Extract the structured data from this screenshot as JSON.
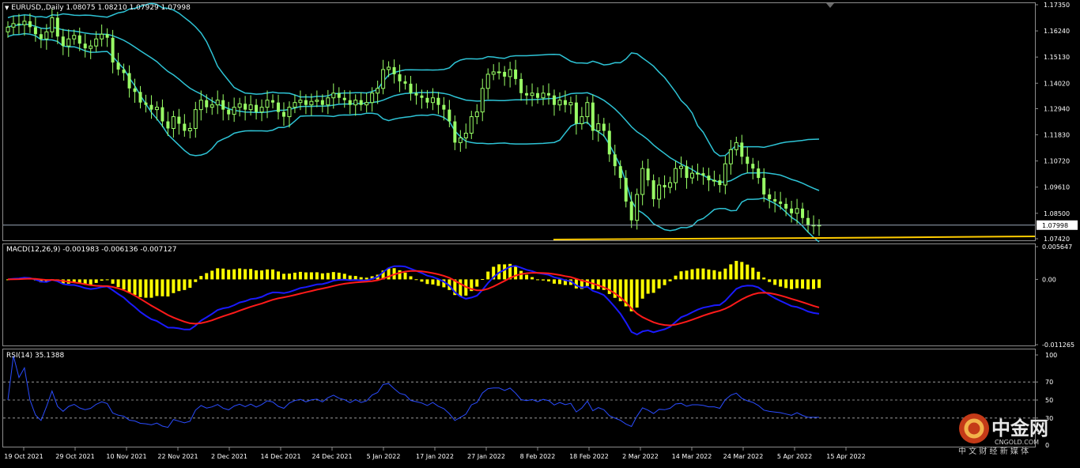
{
  "window": {
    "symbol_title": "EURUSD,,Daily",
    "ohlc_text": "1.08075 1.08210 1.07929 1.07998",
    "current_price": "1.07998"
  },
  "price_axis": [
    "1.17350",
    "1.16240",
    "1.15130",
    "1.14020",
    "1.12940",
    "1.11830",
    "1.10720",
    "1.09610",
    "1.08500",
    "1.07420"
  ],
  "macd": {
    "label": "MACD(12,26,9) -0.001983 -0.006136 -0.007127",
    "axis": [
      "0.005647",
      "0.00",
      "-0.011265"
    ]
  },
  "rsi": {
    "label": "RSI(14) 35.1388",
    "axis": [
      "100",
      "70",
      "50",
      "30",
      "0"
    ],
    "levels": [
      70,
      50,
      30
    ]
  },
  "date_axis": [
    "19 Oct 2021",
    "29 Oct 2021",
    "10 Nov 2021",
    "22 Nov 2021",
    "2 Dec 2021",
    "14 Dec 2021",
    "24 Dec 2021",
    "5 Jan 2022",
    "17 Jan 2022",
    "27 Jan 2022",
    "8 Feb 2022",
    "18 Feb 2022",
    "2 Mar 2022",
    "14 Mar 2022",
    "24 Mar 2022",
    "5 Apr 2022",
    "15 Apr 2022"
  ],
  "watermark": {
    "brand": "中金网",
    "site": "CNGOLD.COM",
    "slogan": "中 文 财 经 新 媒 体"
  },
  "colors": {
    "background": "#000000",
    "bull_candle": "#99ff66",
    "bollinger": "#2ec4d6",
    "macd_hist": "#ffff00",
    "macd_line": "#1a1aff",
    "signal_line": "#ff1a1a",
    "rsi_line": "#2a4cff",
    "panel_border": "#8c8c8c",
    "level_line": "#b0b0b0",
    "price_line": "#9aa8b8"
  },
  "chart_data": {
    "type": "candlestick",
    "instrument": "EURUSD",
    "timeframe": "Daily",
    "price_ylim": [
      1.0742,
      1.1735
    ],
    "closes": [
      1.164,
      1.1655,
      1.165,
      1.1665,
      1.164,
      1.161,
      1.159,
      1.162,
      1.168,
      1.16,
      1.156,
      1.159,
      1.1605,
      1.157,
      1.155,
      1.156,
      1.159,
      1.161,
      1.1595,
      1.149,
      1.146,
      1.1445,
      1.138,
      1.1365,
      1.132,
      1.131,
      1.129,
      1.13,
      1.124,
      1.121,
      1.126,
      1.123,
      1.12,
      1.121,
      1.129,
      1.133,
      1.13,
      1.131,
      1.133,
      1.129,
      1.127,
      1.13,
      1.1315,
      1.129,
      1.131,
      1.128,
      1.13,
      1.133,
      1.132,
      1.128,
      1.126,
      1.13,
      1.132,
      1.133,
      1.131,
      1.1325,
      1.133,
      1.131,
      1.134,
      1.136,
      1.134,
      1.133,
      1.131,
      1.133,
      1.131,
      1.132,
      1.136,
      1.138,
      1.146,
      1.147,
      1.144,
      1.141,
      1.14,
      1.136,
      1.135,
      1.134,
      1.132,
      1.134,
      1.131,
      1.129,
      1.124,
      1.115,
      1.117,
      1.119,
      1.126,
      1.128,
      1.138,
      1.144,
      1.145,
      1.145,
      1.143,
      1.146,
      1.142,
      1.136,
      1.135,
      1.136,
      1.134,
      1.136,
      1.135,
      1.131,
      1.133,
      1.131,
      1.132,
      1.123,
      1.126,
      1.132,
      1.12,
      1.123,
      1.12,
      1.11,
      1.105,
      1.1,
      1.09,
      1.082,
      1.093,
      1.104,
      1.099,
      1.091,
      1.097,
      1.096,
      1.098,
      1.104,
      1.105,
      1.1,
      1.102,
      1.102,
      1.101,
      1.099,
      1.099,
      1.097,
      1.106,
      1.112,
      1.115,
      1.109,
      1.106,
      1.104,
      1.1,
      1.093,
      1.091,
      1.09,
      1.089,
      1.087,
      1.085,
      1.087,
      1.083,
      1.08,
      1.08,
      1.08
    ],
    "macd_ylim": [
      -0.011265,
      0.005647
    ],
    "rsi_ylim": [
      0,
      100
    ]
  }
}
